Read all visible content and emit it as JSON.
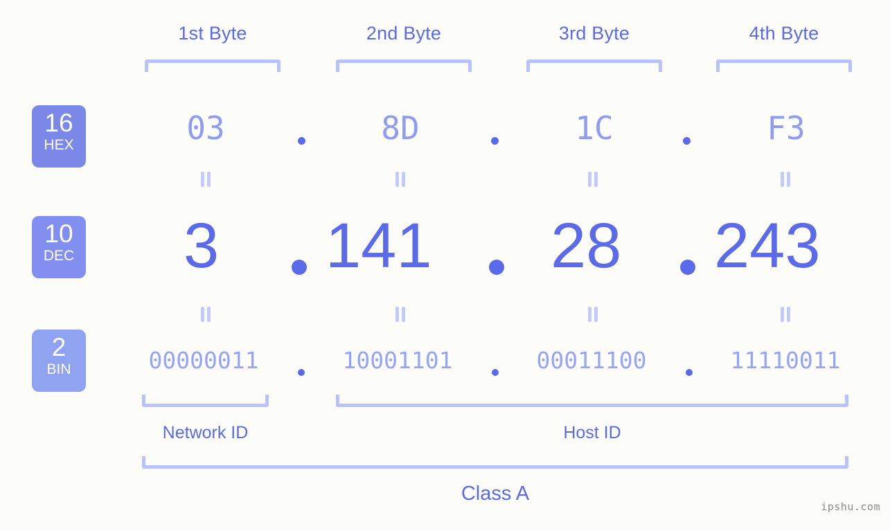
{
  "meta": {
    "background_color": "#fcfdf9",
    "accent_strong": "#5b6ae8",
    "accent_mid": "#8f9cf4",
    "accent_light": "#b9c2fb",
    "watermark": "ipshu.com"
  },
  "byte_headers": [
    {
      "label": "1st Byte"
    },
    {
      "label": "2nd Byte"
    },
    {
      "label": "3rd Byte"
    },
    {
      "label": "4th Byte"
    }
  ],
  "bases": [
    {
      "number": "16",
      "name": "HEX",
      "color": "#7b88e8"
    },
    {
      "number": "10",
      "name": "DEC",
      "color": "#838ff0"
    },
    {
      "number": "2",
      "name": "BIN",
      "color": "#8fa3f0"
    }
  ],
  "separator": ".",
  "rows": {
    "hex": {
      "base_number": "16",
      "base_name": "HEX",
      "octets": [
        "03",
        "8D",
        "1C",
        "F3"
      ]
    },
    "dec": {
      "base_number": "10",
      "base_name": "DEC",
      "octets": [
        "3",
        "141",
        "28",
        "243"
      ]
    },
    "bin": {
      "base_number": "2",
      "base_name": "BIN",
      "octets": [
        "00000011",
        "10001101",
        "00011100",
        "11110011"
      ]
    }
  },
  "ip_address": "3.141.28.243",
  "footer": {
    "network_id_label": "Network ID",
    "host_id_label": "Host ID",
    "class_label": "Class A"
  }
}
